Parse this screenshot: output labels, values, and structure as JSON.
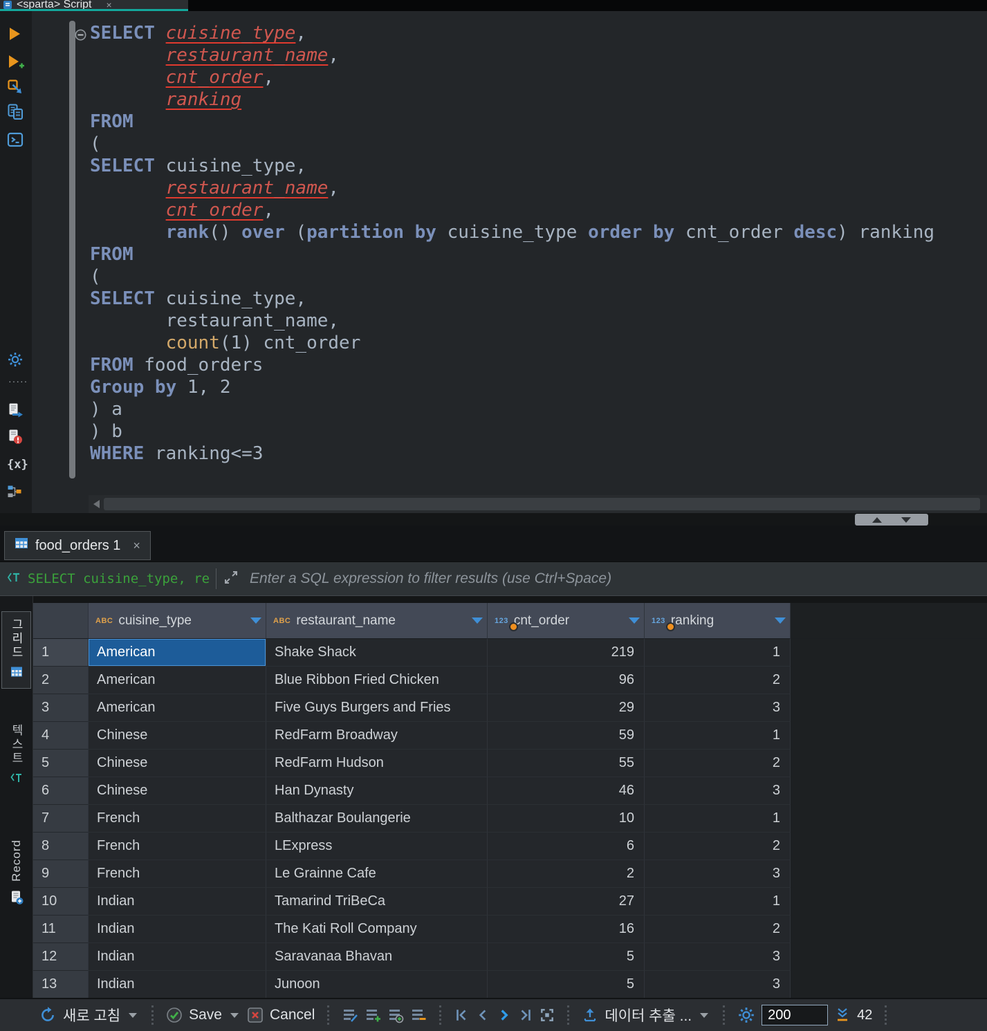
{
  "app": {
    "editor_tab_title": "<sparta> Script",
    "close_glyph": "×"
  },
  "editor": {
    "lines": [
      [
        [
          "k",
          "SELECT"
        ],
        [
          "p",
          " "
        ],
        [
          "e",
          "cuisine_type"
        ],
        [
          "p",
          ","
        ]
      ],
      [
        [
          "p",
          "       "
        ],
        [
          "e",
          "restaurant_name"
        ],
        [
          "p",
          ","
        ]
      ],
      [
        [
          "p",
          "       "
        ],
        [
          "e",
          "cnt_order"
        ],
        [
          "p",
          ","
        ]
      ],
      [
        [
          "p",
          "       "
        ],
        [
          "e",
          "ranking"
        ]
      ],
      [
        [
          "k",
          "FROM"
        ]
      ],
      [
        [
          "p",
          "("
        ]
      ],
      [
        [
          "k",
          "SELECT"
        ],
        [
          "p",
          " cuisine_type,"
        ]
      ],
      [
        [
          "p",
          "       "
        ],
        [
          "e",
          "restaurant_name"
        ],
        [
          "p",
          ","
        ]
      ],
      [
        [
          "p",
          "       "
        ],
        [
          "e",
          "cnt_order"
        ],
        [
          "p",
          ","
        ]
      ],
      [
        [
          "p",
          "       "
        ],
        [
          "k",
          "rank"
        ],
        [
          "p",
          "() "
        ],
        [
          "k",
          "over"
        ],
        [
          "p",
          " ("
        ],
        [
          "k",
          "partition by"
        ],
        [
          "p",
          " cuisine_type "
        ],
        [
          "k",
          "order by"
        ],
        [
          "p",
          " cnt_order "
        ],
        [
          "k",
          "desc"
        ],
        [
          "p",
          ") ranking"
        ]
      ],
      [
        [
          "k",
          "FROM"
        ]
      ],
      [
        [
          "p",
          "("
        ]
      ],
      [
        [
          "k",
          "SELECT"
        ],
        [
          "p",
          " cuisine_type,"
        ]
      ],
      [
        [
          "p",
          "       restaurant_name,"
        ]
      ],
      [
        [
          "p",
          "       "
        ],
        [
          "f",
          "count"
        ],
        [
          "p",
          "(1) cnt_order"
        ]
      ],
      [
        [
          "k",
          "FROM"
        ],
        [
          "p",
          " food_orders"
        ]
      ],
      [
        [
          "k",
          "Group by"
        ],
        [
          "p",
          " 1, 2"
        ]
      ],
      [
        [
          "p",
          ") a"
        ]
      ],
      [
        [
          "p",
          ") b"
        ]
      ],
      [
        [
          "k",
          "WHERE"
        ],
        [
          "p",
          " ranking<=3"
        ]
      ]
    ]
  },
  "left_toolbar": {
    "braces_label": "{x}",
    "overflow_dots": "·····"
  },
  "results": {
    "tab_title": "food_orders 1",
    "filter": {
      "sql_preview": "SELECT cuisine_type, rest",
      "placeholder": "Enter a SQL expression to filter results (use Ctrl+Space)"
    },
    "side_tabs": {
      "grid": "그리드",
      "text": "텍스트",
      "record": "Record"
    },
    "table": {
      "type_text": "ABC",
      "type_num": "123",
      "columns": [
        {
          "label": "cuisine_type",
          "kind": "text"
        },
        {
          "label": "restaurant_name",
          "kind": "text"
        },
        {
          "label": "cnt_order",
          "kind": "number"
        },
        {
          "label": "ranking",
          "kind": "number"
        }
      ],
      "rows": [
        [
          "American",
          "Shake Shack",
          219,
          1
        ],
        [
          "American",
          "Blue Ribbon Fried Chicken",
          96,
          2
        ],
        [
          "American",
          "Five Guys Burgers and Fries",
          29,
          3
        ],
        [
          "Chinese",
          "RedFarm Broadway",
          59,
          1
        ],
        [
          "Chinese",
          "RedFarm Hudson",
          55,
          2
        ],
        [
          "Chinese",
          "Han Dynasty",
          46,
          3
        ],
        [
          "French",
          "Balthazar Boulangerie",
          10,
          1
        ],
        [
          "French",
          "LExpress",
          6,
          2
        ],
        [
          "French",
          "Le Grainne Cafe",
          2,
          3
        ],
        [
          "Indian",
          "Tamarind TriBeCa",
          27,
          1
        ],
        [
          "Indian",
          "The Kati Roll Company",
          16,
          2
        ],
        [
          "Indian",
          "Saravanaa Bhavan",
          5,
          3
        ],
        [
          "Indian",
          "Junoon",
          5,
          3
        ]
      ],
      "selected": {
        "row": 0,
        "col": 0
      }
    }
  },
  "statusbar": {
    "refresh": "새로 고침",
    "save": "Save",
    "cancel": "Cancel",
    "export": "데이터 추출 ...",
    "fetch_size": "200",
    "row_count": "42"
  }
}
